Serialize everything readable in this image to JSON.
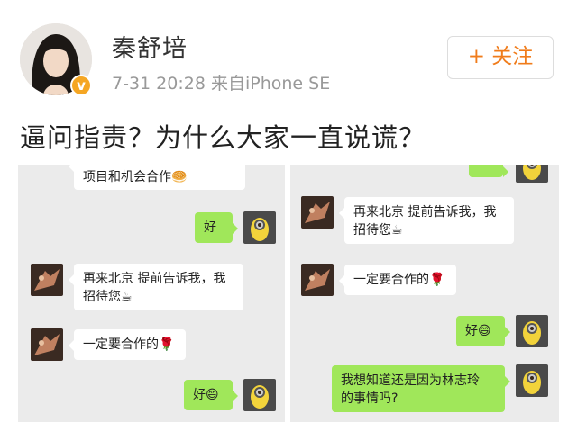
{
  "header": {
    "username": "秦舒培",
    "meta": "7-31 20:28  来自iPhone SE",
    "follow_label": "+ 关注"
  },
  "post": {
    "text": "逼问指责？为什么大家一直说谎？"
  },
  "chat_left": {
    "messages": [
      {
        "from": "other",
        "text": "项目和机会合作🥯"
      },
      {
        "from": "self",
        "text": "好"
      },
      {
        "from": "other",
        "text": "再来北京 提前告诉我，我\n招待您☕"
      },
      {
        "from": "other",
        "text": "一定要合作的🌹"
      },
      {
        "from": "self",
        "text": "好😄"
      }
    ]
  },
  "chat_right": {
    "messages": [
      {
        "from": "other",
        "text": "再来北京 提前告诉我，我\n招待您☕"
      },
      {
        "from": "other",
        "text": "一定要合作的🌹"
      },
      {
        "from": "self",
        "text": "好😄"
      },
      {
        "from": "self",
        "text": "我想知道还是因为林志玲\n的事情吗?"
      }
    ]
  },
  "colors": {
    "accent": "#f07c1b",
    "bubble_green": "#a0e75a",
    "verify": "#f5a623"
  }
}
